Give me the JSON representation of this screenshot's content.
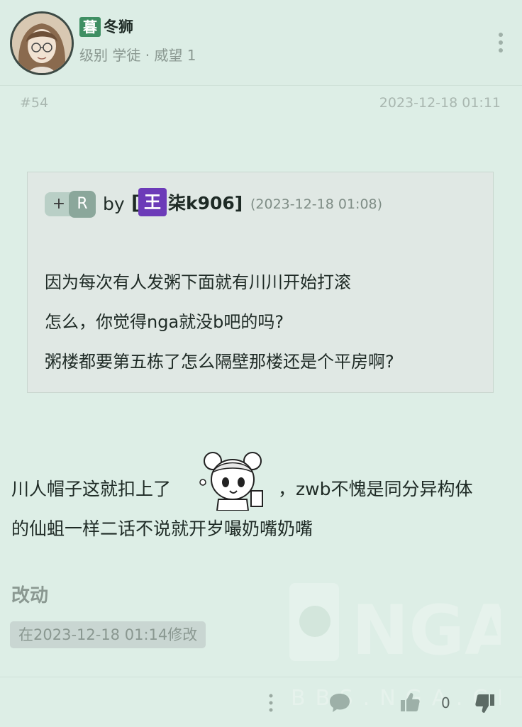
{
  "user": {
    "badge": "暮",
    "name": "冬狮",
    "meta": "级别 学徒 · 威望 1"
  },
  "post": {
    "number": "#54",
    "timestamp": "2023-12-18 01:11"
  },
  "quote": {
    "plus_label": "+",
    "reply_label": "R",
    "by": "by",
    "bracket_open": "[",
    "author_badge": "王",
    "author": "柒k906]",
    "date": "(2023-12-18 01:08)",
    "lines": [
      "因为每次有人发粥下面就有川川开始打滚",
      "怎么，你觉得nga就没b吧的吗?",
      "粥楼都要第五栋了怎么隔壁那楼还是个平房啊?"
    ]
  },
  "body": {
    "line1_before": "川人帽子这就扣上了",
    "line1_after": "，zwb不愧是同分异构体",
    "line2": "的仙蛆一样二话不说就开岁嘬奶嘴奶嘴"
  },
  "edit": {
    "title": "改动",
    "note": "在2023-12-18 01:14修改"
  },
  "watermark": {
    "logo": "NGA",
    "url": "BBS.NGA.CN"
  },
  "actions": {
    "like_count": "0"
  },
  "icons": {
    "more": "more-vert-icon",
    "comment": "comment-icon",
    "like": "thumbs-up-icon",
    "dislike": "thumbs-down-icon"
  },
  "colors": {
    "background": "#ddeee6",
    "user_badge": "#3f8f63",
    "author_badge": "#6c3bb8",
    "muted_text": "#8a9891"
  }
}
